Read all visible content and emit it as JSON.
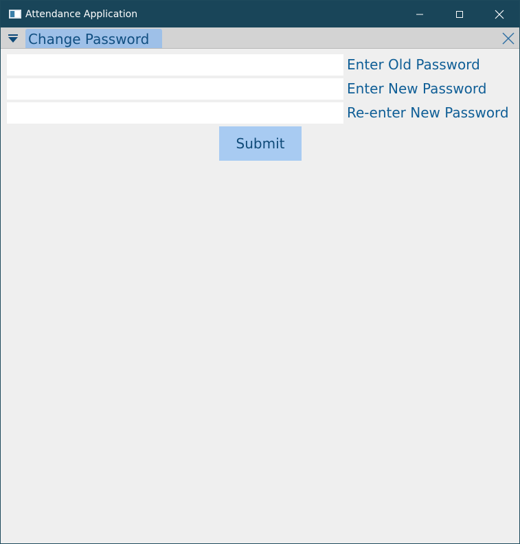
{
  "window": {
    "title": "Attendance Application"
  },
  "titlebar_buttons": {
    "minimize": "minimize-icon",
    "maximize": "maximize-icon",
    "close": "close-icon"
  },
  "tabbar": {
    "dropdown_icon": "triangle-down-icon",
    "active_tab_label": "Change Password",
    "close_icon": "close-icon"
  },
  "form": {
    "old_password": {
      "label": "Enter Old Password",
      "value": ""
    },
    "new_password": {
      "label": "Enter New Password",
      "value": ""
    },
    "confirm_password": {
      "label": "Re-enter New Password",
      "value": ""
    },
    "submit_label": "Submit"
  },
  "colors": {
    "titlebar": "#194559",
    "tab_active": "#9ec0e8",
    "label_text": "#0f5e96",
    "submit_bg": "#a8cbf2",
    "background": "#efefef"
  }
}
